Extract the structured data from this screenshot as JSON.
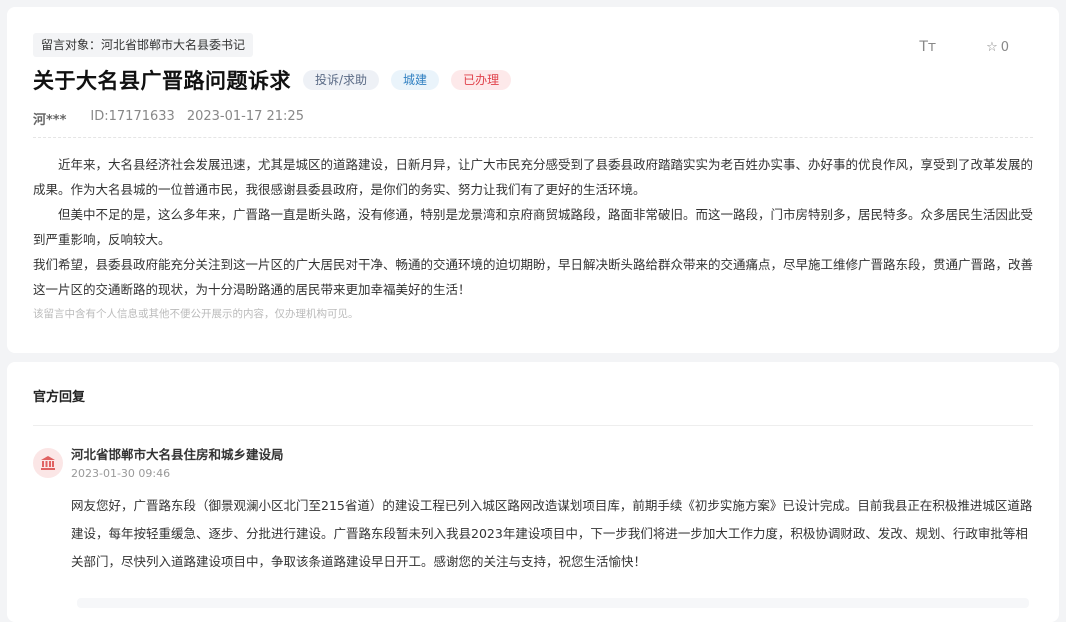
{
  "message": {
    "target_label": "留言对象：河北省邯郸市大名县委书记",
    "title": "关于大名县广晋路问题诉求",
    "tags": [
      "投诉/求助",
      "城建",
      "已办理"
    ],
    "colors": {
      "tag_type": "#5a6a85",
      "tag_cat": "#2f7fc1",
      "tag_status": "#e0424b"
    },
    "font_size_icon": "Tт",
    "star_count": "0",
    "author": "河***",
    "id": "ID:17171633",
    "datetime": "2023-01-17 21:25",
    "paragraphs": [
      "　　近年来，大名县经济社会发展迅速，尤其是城区的道路建设，日新月异，让广大市民充分感受到了县委县政府踏踏实实为老百姓办实事、办好事的优良作风，享受到了改革发展的成果。作为大名县城的一位普通市民，我很感谢县委县政府，是你们的务实、努力让我们有了更好的生活环境。",
      "　　但美中不足的是，这么多年来，广晋路一直是断头路，没有修通，特别是龙景湾和京府商贸城路段，路面非常破旧。而这一路段，门市房特别多，居民特多。众多居民生活因此受到严重影响，反响较大。",
      "我们希望，县委县政府能充分关注到这一片区的广大居民对干净、畅通的交通环境的迫切期盼，早日解决断头路给群众带来的交通痛点，尽早施工维修广晋路东段，贯通广晋路，改善这一片区的交通断路的现状，为十分渴盼路通的居民带来更加幸福美好的生活！"
    ],
    "privacy_note": "该留言中含有个人信息或其他不便公开展示的内容，仅办理机构可见。"
  },
  "reply": {
    "heading": "官方回复",
    "org_name": "河北省邯郸市大名县住房和城乡建设局",
    "org_time": "2023-01-30 09:46",
    "body": "网友您好，广晋路东段（御景观澜小区北门至215省道）的建设工程已列入城区路网改造谋划项目库，前期手续《初步实施方案》已设计完成。目前我县正在积极推进城区道路建设，每年按轻重缓急、逐步、分批进行建设。广晋路东段暂未列入我县2023年建设项目中，下一步我们将进一步加大工作力度，积极协调财政、发改、规划、行政审批等相关部门，尽快列入道路建设项目中，争取该条道路建设早日开工。感谢您的关注与支持，祝您生活愉快！"
  },
  "icons": {
    "font_size": "font-size-icon",
    "star": "star-icon",
    "org": "government-building-icon"
  }
}
